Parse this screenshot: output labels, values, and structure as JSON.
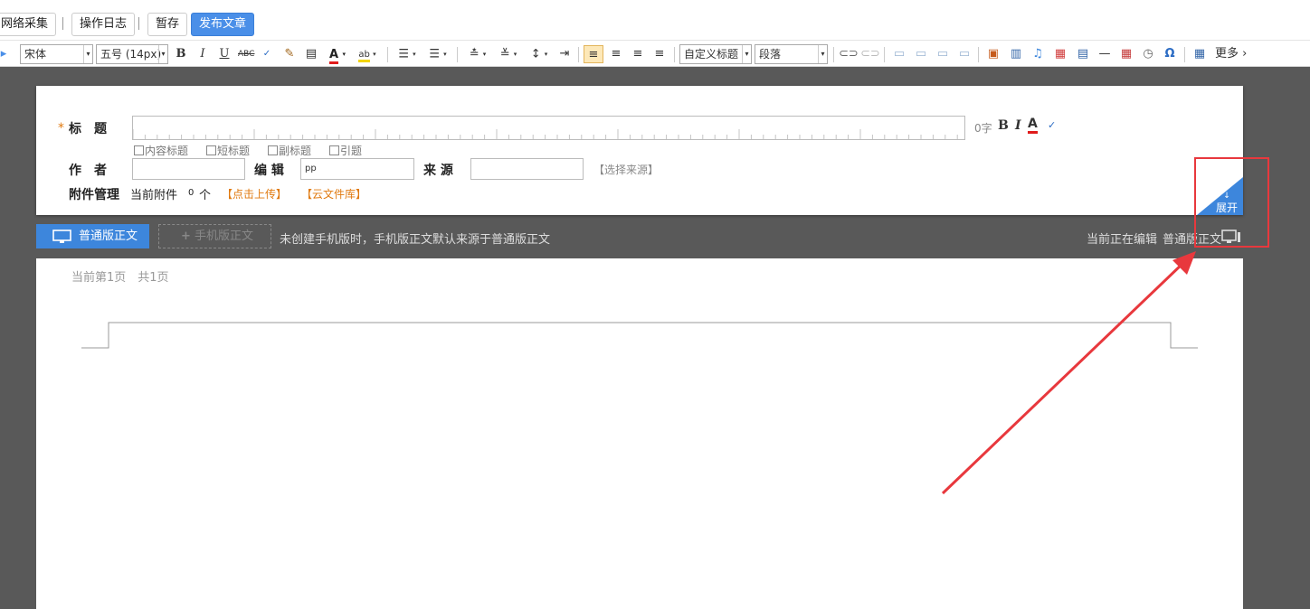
{
  "topbar": {
    "collect": "网络采集",
    "log": "操作日志",
    "save_draft": "暂存",
    "publish": "发布文章"
  },
  "toolbar": {
    "font_family": "宋体",
    "font_size": "五号 (14px)",
    "heading": "自定义标题",
    "paragraph": "段落",
    "more": "更多"
  },
  "meta": {
    "title_label": "标　题",
    "required_mark": "*",
    "char_count": "0字",
    "checks": [
      "内容标题",
      "短标题",
      "副标题",
      "引题"
    ],
    "author_label": "作　者",
    "editor_label": "编 辑",
    "editor_value": "pp",
    "source_label": "来 源",
    "choose_source": "【选择来源】",
    "attach_label": "附件管理",
    "current_attach": "当前附件",
    "attach_count": "0",
    "attach_unit": "个",
    "upload": "【点击上传】",
    "cloud": "【云文件库】",
    "expand": "展开"
  },
  "tabs": {
    "normal": "普通版正文",
    "mobile": "手机版正文",
    "note": "未创建手机版时，手机版正文默认来源于普通版正文",
    "editing_prefix": "当前正在编辑",
    "editing_value": "普通版正文"
  },
  "page": {
    "page_info": "当前第1页　共1页"
  },
  "colors": {
    "accent": "#3d86dc",
    "highlight": "#e8383d",
    "link": "#e07a10"
  }
}
